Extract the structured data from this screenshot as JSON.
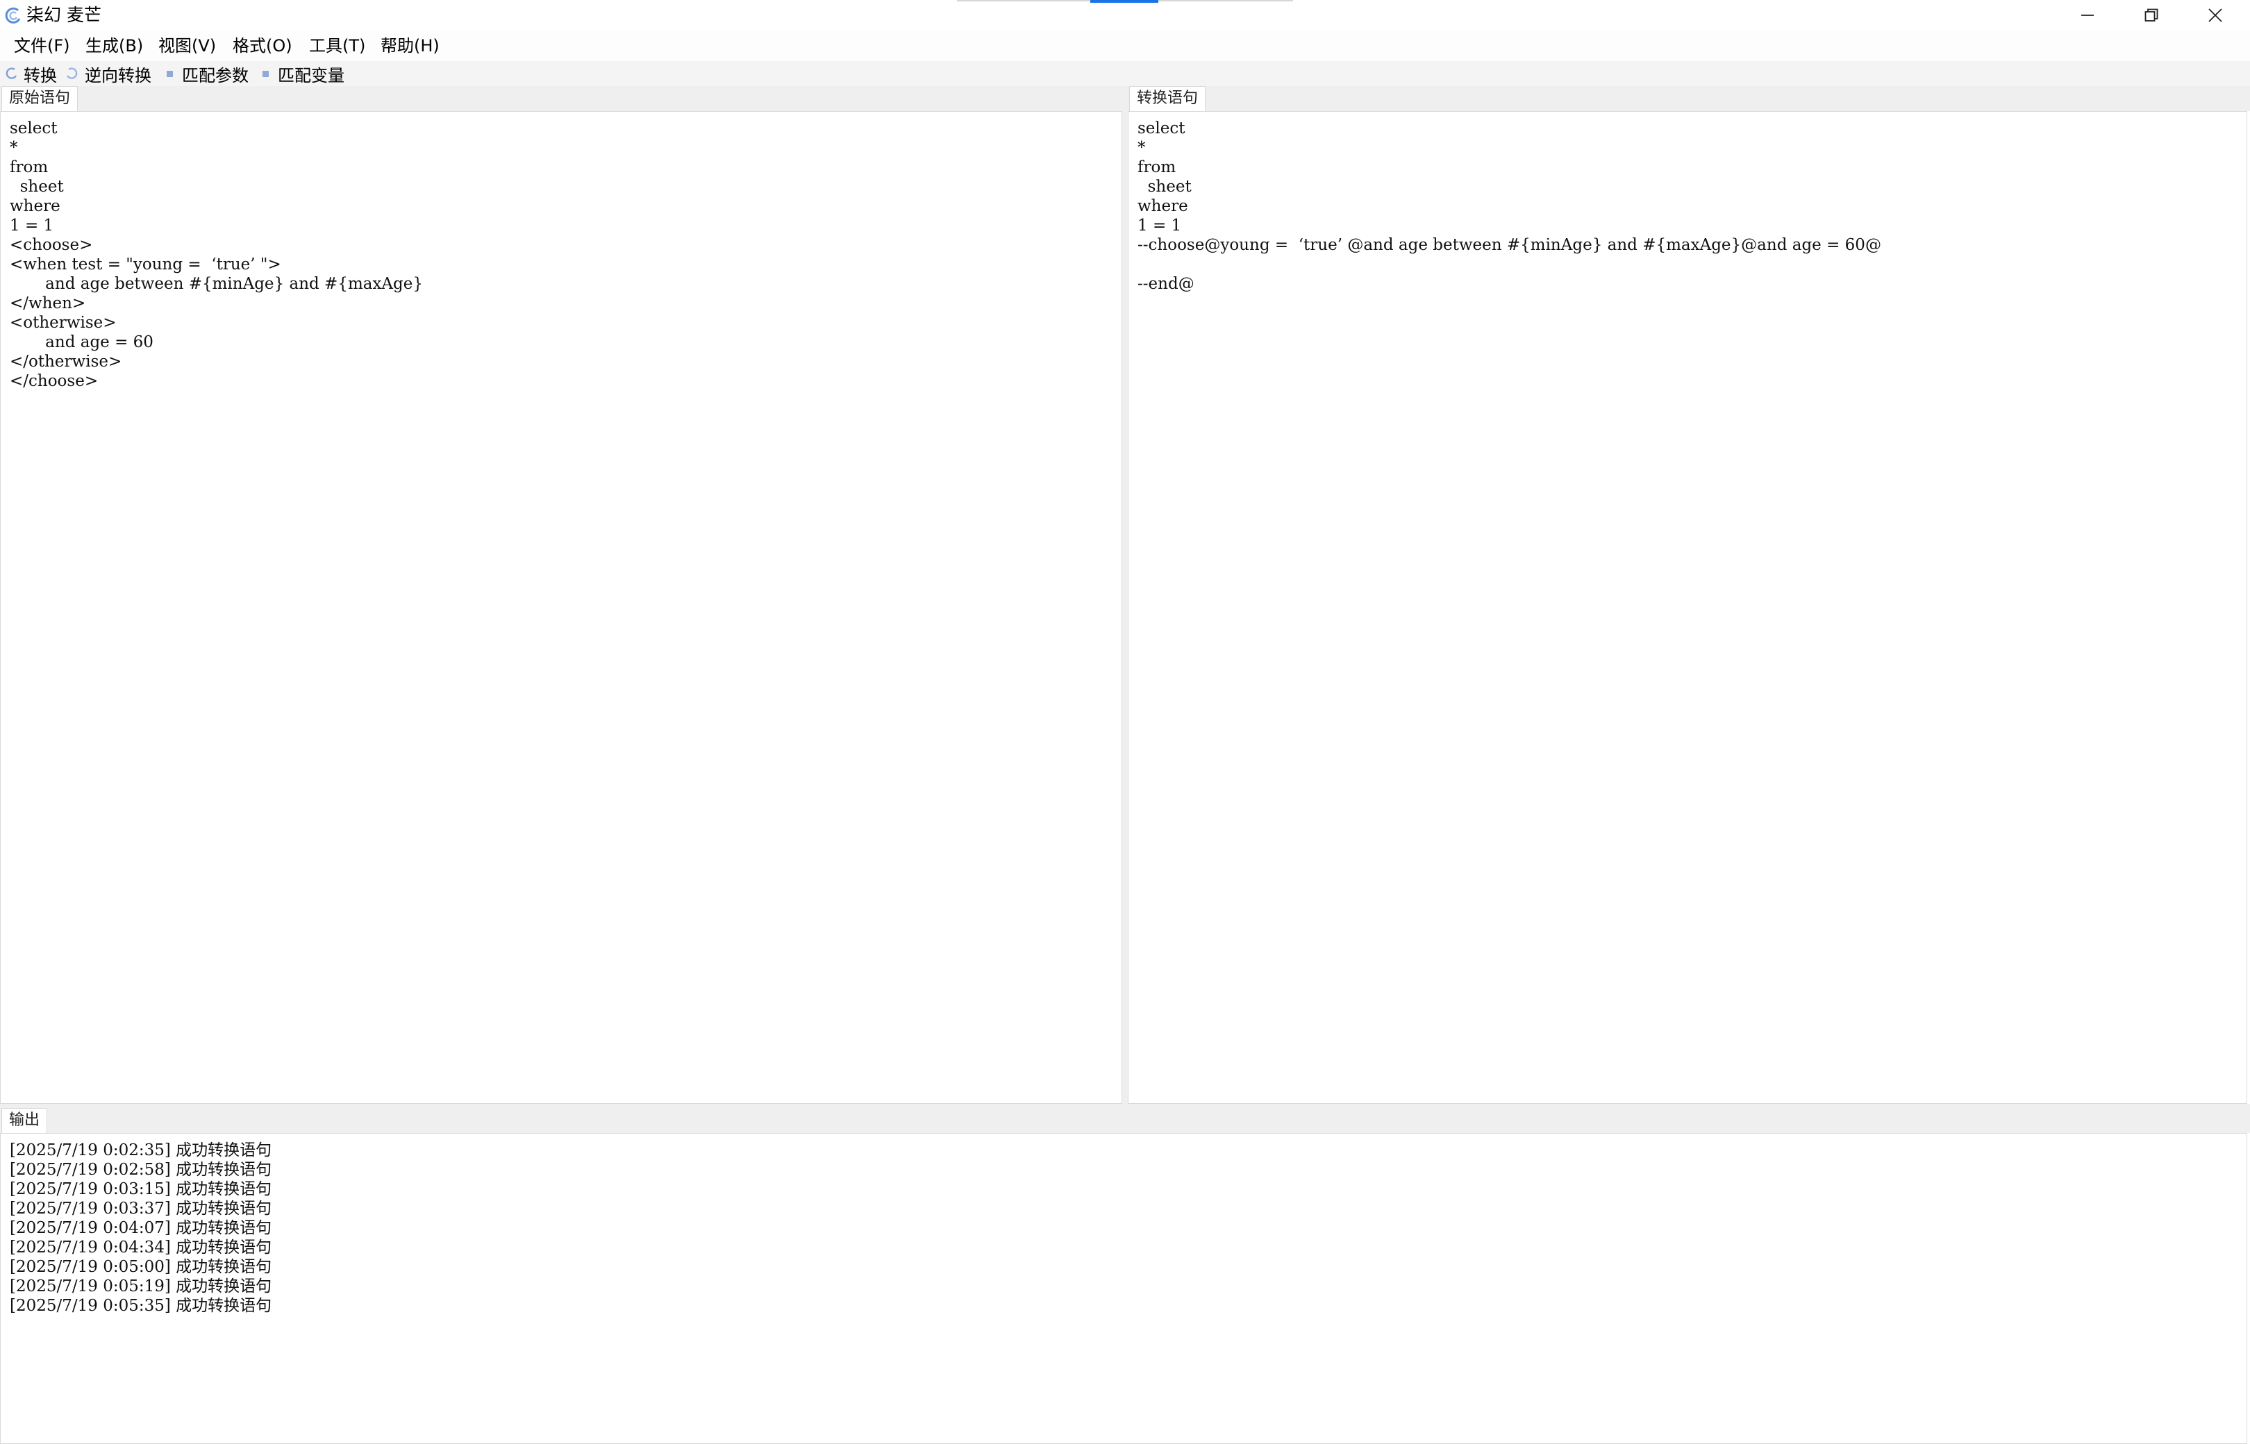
{
  "window": {
    "title": "柒幻 麦芒",
    "controls": {
      "minimize": "minimize",
      "restore": "restore",
      "close": "close"
    }
  },
  "menu": [
    {
      "label": "文件(F)"
    },
    {
      "label": "生成(B)"
    },
    {
      "label": "视图(V)"
    },
    {
      "label": "格式(O)"
    },
    {
      "label": "工具(T)"
    },
    {
      "label": "帮助(H)"
    }
  ],
  "toolbar": [
    {
      "label": "转换",
      "icon": "convert-icon"
    },
    {
      "label": "逆向转换",
      "icon": "reverse-convert-icon"
    },
    {
      "label": "匹配参数",
      "icon": "square-bullet-icon"
    },
    {
      "label": "匹配变量",
      "icon": "square-bullet-icon"
    }
  ],
  "source": {
    "tab": "原始语句",
    "lines": [
      "select",
      "*",
      "from",
      "  sheet",
      "where",
      "1 = 1",
      "<choose>",
      "<when test = \"young =  ‘true’ \">",
      "       and age between #{minAge} and #{maxAge}",
      "</when>",
      "<otherwise>",
      "       and age = 60",
      "</otherwise>",
      "</choose>"
    ]
  },
  "result": {
    "tab": "转换语句",
    "lines": [
      "select",
      "*",
      "from",
      "  sheet",
      "where",
      "1 = 1",
      "--choose@young =  ‘true’ @and age between #{minAge} and #{maxAge}@and age = 60@",
      "",
      "--end@"
    ]
  },
  "output": {
    "tab": "输出",
    "lines": [
      "[2025/7/19 0:02:35] 成功转换语句",
      "[2025/7/19 0:02:58] 成功转换语句",
      "[2025/7/19 0:03:15] 成功转换语句",
      "[2025/7/19 0:03:37] 成功转换语句",
      "[2025/7/19 0:04:07] 成功转换语句",
      "[2025/7/19 0:04:34] 成功转换语句",
      "[2025/7/19 0:05:00] 成功转换语句",
      "[2025/7/19 0:05:19] 成功转换语句",
      "[2025/7/19 0:05:35] 成功转换语句"
    ]
  },
  "colors": {
    "accent": "#1a73e8",
    "icon_blue": "#7f9fd6",
    "tab_strip": "#efefef"
  }
}
